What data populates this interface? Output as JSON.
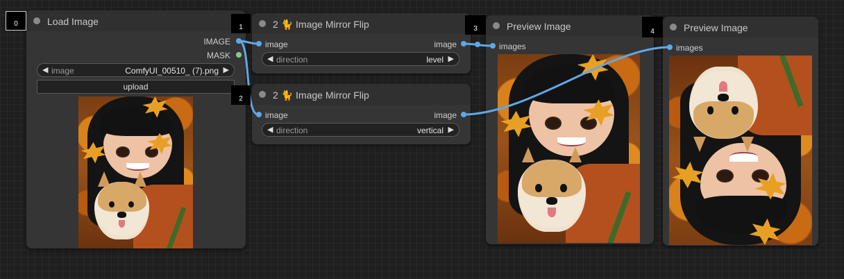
{
  "badges": [
    "0",
    "1",
    "2",
    "3",
    "4"
  ],
  "nodes": {
    "load_image": {
      "title": "Load Image",
      "outputs": [
        "IMAGE",
        "MASK"
      ],
      "image_widget": {
        "label": "image",
        "value": "ComfyUI_00510_ (7).png"
      },
      "upload_label": "upload"
    },
    "mirror_flip_1": {
      "title_prefix": "2",
      "title": "Image Mirror Flip",
      "emoji_icon": "cat-icon",
      "input": "image",
      "output": "image",
      "direction_widget": {
        "label": "direction",
        "value": "level"
      }
    },
    "mirror_flip_2": {
      "title_prefix": "2",
      "title": "Image Mirror Flip",
      "emoji_icon": "cat-icon",
      "input": "image",
      "output": "image",
      "direction_widget": {
        "label": "direction",
        "value": "vertical"
      }
    },
    "preview_1": {
      "title": "Preview Image",
      "input": "images"
    },
    "preview_2": {
      "title": "Preview Image",
      "input": "images"
    }
  },
  "colors": {
    "canvas": "#1f1f1f",
    "node_body": "#353535",
    "node_header": "#303030",
    "image_wire": "#5fa8e8",
    "mask_slot": "#86c98f",
    "leaf_accent": "#e8a024"
  }
}
